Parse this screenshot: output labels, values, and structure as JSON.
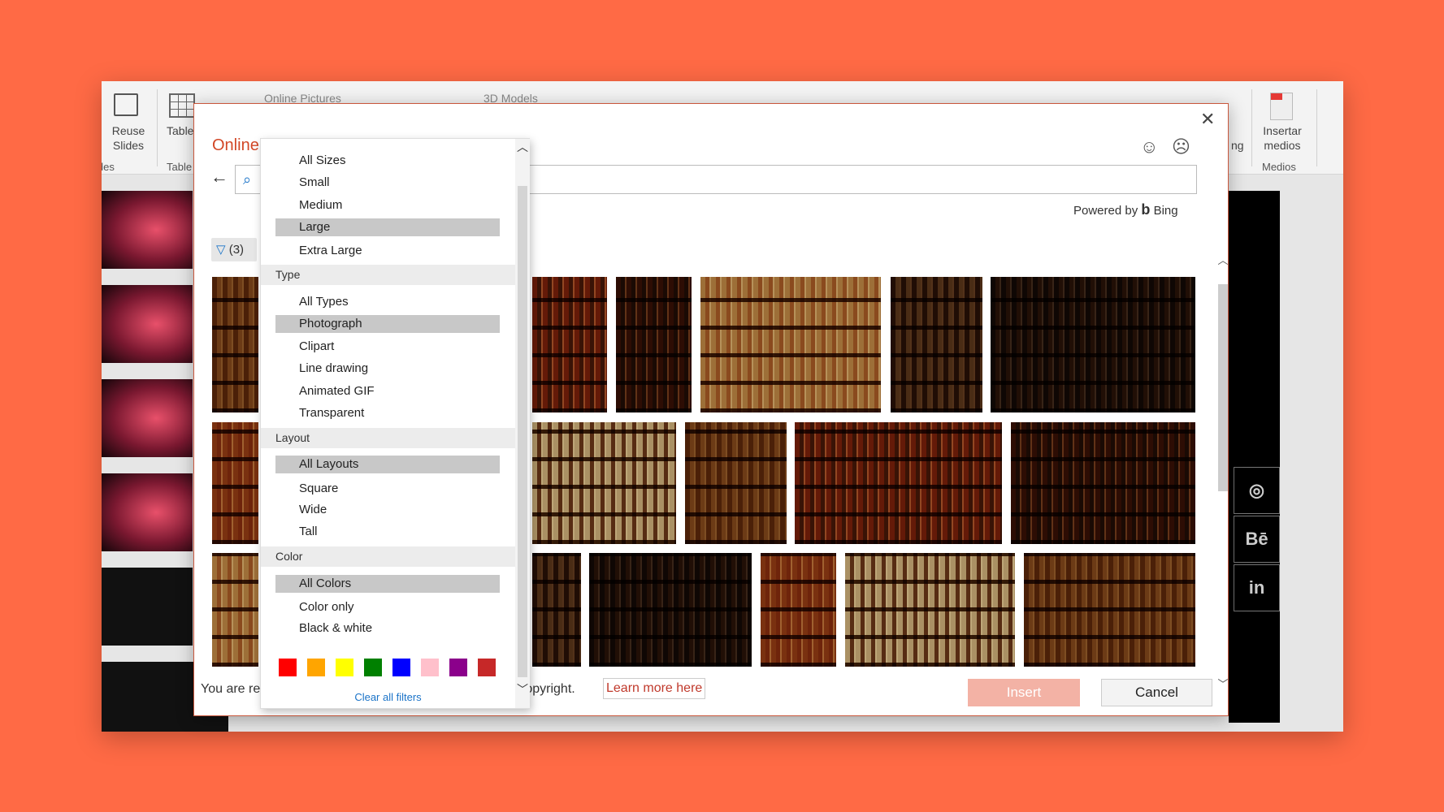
{
  "ribbon": {
    "reuse_slides": "Reuse Slides",
    "table": "Table",
    "online_pictures": "Online Pictures",
    "models_3d": "3D Models",
    "insertar_medios": "Insertar medios",
    "group_slides": "ides",
    "group_tables": "Table",
    "group_medios": "Medios",
    "partial_label": "ng"
  },
  "social": [
    "dribbble-icon",
    "behance-icon",
    "linkedin-icon"
  ],
  "social_text": [
    "◎",
    "Bē",
    "in"
  ],
  "dialog": {
    "title": "Online",
    "search_placeholder": "",
    "powered_by": "Powered by",
    "bing": "Bing",
    "filter_count": "(3)",
    "footer_left": "You are re",
    "footer_right": "g copyright.",
    "learn_more": "Learn more here",
    "insert": "Insert",
    "cancel": "Cancel"
  },
  "dropdown": {
    "sizes": [
      "All Sizes",
      "Small",
      "Medium",
      "Large",
      "Extra Large"
    ],
    "type_header": "Type",
    "types": [
      "All Types",
      "Photograph",
      "Clipart",
      "Line drawing",
      "Animated GIF",
      "Transparent"
    ],
    "layout_header": "Layout",
    "layouts": [
      "All Layouts",
      "Square",
      "Wide",
      "Tall"
    ],
    "color_header": "Color",
    "colors": [
      "All Colors",
      "Color only",
      "Black & white"
    ],
    "selected": {
      "size": "Large",
      "type": "Photograph",
      "layout": "All Layouts",
      "color": "All Colors"
    },
    "swatches": [
      "#ff0000",
      "#ffa500",
      "#ffff00",
      "#008000",
      "#0000ff",
      "#ffc0cb",
      "#8b008b",
      "#c62828"
    ],
    "clear": "Clear all filters"
  },
  "image_colors": [
    "#8a5a2e",
    "#a0522d",
    "#6b3a1e",
    "#c8a878",
    "#5b3a22",
    "#3d2a1f",
    "#b07040",
    "#d0c0a0"
  ]
}
